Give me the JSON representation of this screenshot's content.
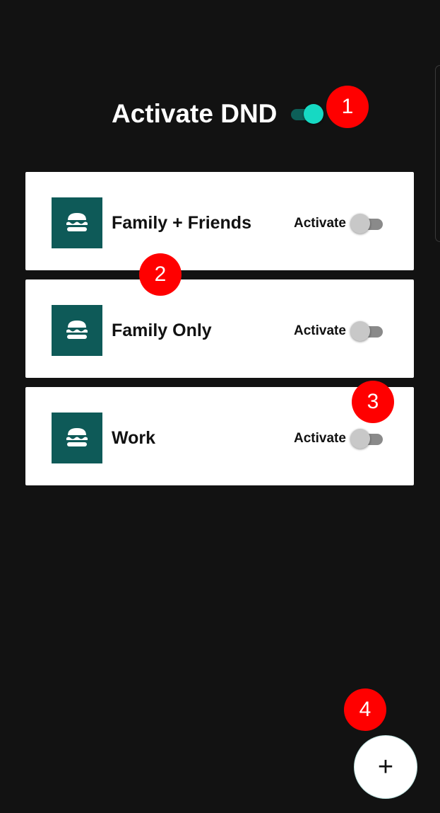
{
  "header": {
    "title": "Activate DND",
    "master_switch": "on"
  },
  "profiles": [
    {
      "name": "Family + Friends",
      "activate_label": "Activate",
      "switch": "off",
      "icon": "burger-icon"
    },
    {
      "name": "Family Only",
      "activate_label": "Activate",
      "switch": "off",
      "icon": "burger-icon"
    },
    {
      "name": "Work",
      "activate_label": "Activate",
      "switch": "off",
      "icon": "burger-icon"
    }
  ],
  "annotations": [
    "1",
    "2",
    "3",
    "4"
  ],
  "fab": {
    "label": "+",
    "icon": "plus-icon"
  },
  "colors": {
    "background": "#121212",
    "card": "#ffffff",
    "avatar": "#0e5a58",
    "switch_on_thumb": "#16d9c3",
    "switch_on_track": "#0d5f58",
    "switch_off_thumb": "#c8c8c8",
    "switch_off_track": "#8a8a8a",
    "badge": "#ff0000"
  }
}
